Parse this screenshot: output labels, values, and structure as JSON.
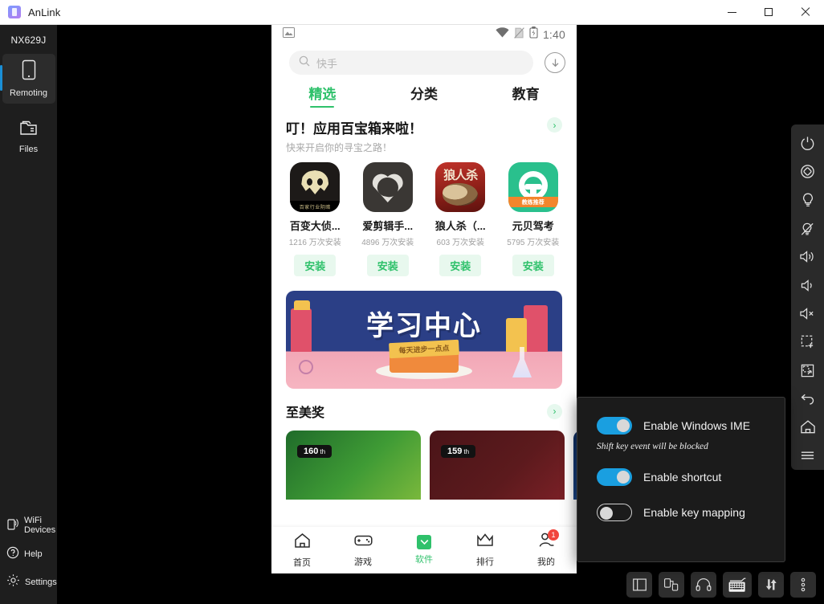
{
  "window": {
    "title": "AnLink",
    "logo_icon": "anlink-logo-icon",
    "minimize_label": "Minimize",
    "maximize_label": "Maximize",
    "close_label": "Close"
  },
  "sidebar": {
    "device_name": "NX629J",
    "items": [
      {
        "label": "Remoting",
        "icon": "phone-icon",
        "active": true
      },
      {
        "label": "Files",
        "icon": "folder-icon",
        "active": false
      }
    ],
    "bottom_items": [
      {
        "label": "WiFi Devices",
        "icon": "wifi-device-icon"
      },
      {
        "label": "Help",
        "icon": "question-circle-icon"
      },
      {
        "label": "Settings",
        "icon": "gear-icon"
      }
    ]
  },
  "phone": {
    "status_bar": {
      "left_icon": "image-icon",
      "wifi_icon": "wifi-icon",
      "sim_icon": "sim-off-icon",
      "battery_icon": "battery-charging-icon",
      "time": "1:40"
    },
    "search": {
      "icon": "search-icon",
      "placeholder": "快手",
      "download_icon": "download-circle-icon"
    },
    "tabs": [
      {
        "label": "精选",
        "active": true
      },
      {
        "label": "分类",
        "active": false
      },
      {
        "label": "教育",
        "active": false
      }
    ],
    "promo": {
      "title": "叮！应用百宝箱来啦！",
      "subtitle": "快来开启你的寻宝之路！",
      "arrow_icon": "chevron-right-icon"
    },
    "apps": [
      {
        "name": "百变大侦...",
        "installs": "1216 万次安装",
        "button": "安装",
        "icon": "baibian-app-icon",
        "badge": "百家行业阴暗"
      },
      {
        "name": "爱剪辑手...",
        "installs": "4896 万次安装",
        "button": "安装",
        "icon": "aijianji-app-icon"
      },
      {
        "name": "狼人杀（...",
        "installs": "603 万次安装",
        "button": "安装",
        "icon": "langrensha-app-icon",
        "title_art": "狼人杀"
      },
      {
        "name": "元贝驾考",
        "installs": "5795 万次安装",
        "button": "安装",
        "icon": "yuanbei-app-icon",
        "ribbon": "教练推荐"
      }
    ],
    "banner": {
      "title": "学习中心",
      "sub": "每天进步一点点"
    },
    "award": {
      "title": "至美奖",
      "arrow_icon": "chevron-right-icon",
      "cards": [
        {
          "rank": "160",
          "suffix": "th"
        },
        {
          "rank": "159",
          "suffix": "th"
        },
        {
          "rank": "",
          "suffix": ""
        }
      ]
    },
    "bottom_nav": [
      {
        "label": "首页",
        "icon": "home-icon",
        "active": false,
        "badge": ""
      },
      {
        "label": "游戏",
        "icon": "gamepad-icon",
        "active": false,
        "badge": ""
      },
      {
        "label": "软件",
        "icon": "software-icon",
        "active": true,
        "badge": ""
      },
      {
        "label": "排行",
        "icon": "crown-icon",
        "active": false,
        "badge": ""
      },
      {
        "label": "我的",
        "icon": "user-icon",
        "active": false,
        "badge": "1"
      }
    ]
  },
  "right_toolbar": [
    {
      "icon": "power-icon",
      "label": "Power"
    },
    {
      "icon": "rotate-screen-icon",
      "label": "Rotate"
    },
    {
      "icon": "flashlight-on-icon",
      "label": "Flashlight on"
    },
    {
      "icon": "flashlight-off-icon",
      "label": "Flashlight off"
    },
    {
      "icon": "volume-up-icon",
      "label": "Volume up"
    },
    {
      "icon": "volume-down-icon",
      "label": "Volume down"
    },
    {
      "icon": "volume-mute-icon",
      "label": "Mute"
    },
    {
      "icon": "screenshot-region-icon",
      "label": "Capture region"
    },
    {
      "icon": "screen-record-icon",
      "label": "Screen capture"
    },
    {
      "icon": "back-icon",
      "label": "Back"
    },
    {
      "icon": "home-icon",
      "label": "Home"
    },
    {
      "icon": "menu-icon",
      "label": "Recents"
    }
  ],
  "bottom_toolbar": [
    {
      "icon": "layout-panel-icon",
      "label": "Layout",
      "active": false
    },
    {
      "icon": "device-link-icon",
      "label": "Devices",
      "active": false
    },
    {
      "icon": "headphones-icon",
      "label": "Audio",
      "active": false
    },
    {
      "icon": "keyboard-icon",
      "label": "Keyboard",
      "active": true
    },
    {
      "icon": "transfer-icon",
      "label": "Transfer",
      "active": false
    },
    {
      "icon": "more-vertical-icon",
      "label": "More",
      "active": false
    }
  ],
  "popup": {
    "options": [
      {
        "label": "Enable Windows IME",
        "state": "on"
      },
      {
        "label": "Enable shortcut",
        "state": "on"
      },
      {
        "label": "Enable key mapping",
        "state": "off"
      }
    ],
    "note": "Shift key event will be blocked"
  },
  "colors": {
    "accent_blue": "#1a9fe0",
    "accent_green": "#2fc16b",
    "badge_red": "#f1453d",
    "sidebar_bg": "#1e1e1e",
    "toolbar_bg": "#2a2a2a"
  }
}
